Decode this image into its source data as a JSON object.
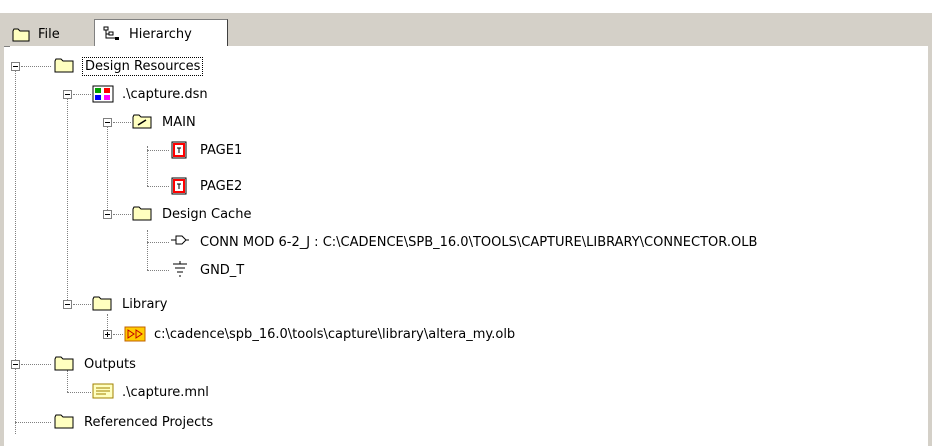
{
  "tabs": [
    {
      "label": "File",
      "icon": "folder-icon",
      "active": false
    },
    {
      "label": "Hierarchy",
      "icon": "hierarchy-icon",
      "active": true
    }
  ],
  "tree": {
    "design_resources": "Design Resources",
    "design_file": ".\\capture.dsn",
    "main": "MAIN",
    "page1": "PAGE1",
    "page2": "PAGE2",
    "design_cache": "Design Cache",
    "cache_conn": "CONN MOD 6-2_J : C:\\CADENCE\\SPB_16.0\\TOOLS\\CAPTURE\\LIBRARY\\CONNECTOR.OLB",
    "cache_gnd": "GND_T",
    "library": "Library",
    "library_file": "c:\\cadence\\spb_16.0\\tools\\capture\\library\\altera_my.olb",
    "outputs": "Outputs",
    "output_file": ".\\capture.mnl",
    "referenced_projects": "Referenced Projects"
  },
  "colors": {
    "folder_fill": "#ffffc0",
    "folder_stroke": "#000000",
    "page_red": "#ff0000",
    "tab_bg": "#d4d0c8"
  }
}
